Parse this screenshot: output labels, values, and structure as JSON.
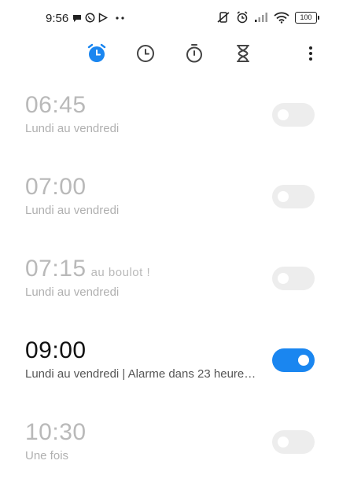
{
  "status_bar": {
    "time": "9:56",
    "battery": "100"
  },
  "tabs": [
    {
      "name": "alarm",
      "icon": "alarm-clock-icon",
      "active": true
    },
    {
      "name": "world-clock",
      "icon": "clock-icon",
      "active": false
    },
    {
      "name": "stopwatch",
      "icon": "stopwatch-icon",
      "active": false
    },
    {
      "name": "timer",
      "icon": "hourglass-icon",
      "active": false
    }
  ],
  "alarms": [
    {
      "time": "06:45",
      "label": "",
      "repeat": "Lundi au vendredi",
      "enabled": false
    },
    {
      "time": "07:00",
      "label": "",
      "repeat": "Lundi au vendredi",
      "enabled": false
    },
    {
      "time": "07:15",
      "label": "au boulot !",
      "repeat": "Lundi au vendredi",
      "enabled": false
    },
    {
      "time": "09:00",
      "label": "",
      "repeat": "Lundi au vendredi  |  Alarme dans 23 heure…",
      "enabled": true
    },
    {
      "time": "10:30",
      "label": "",
      "repeat": "Une fois",
      "enabled": false
    }
  ],
  "colors": {
    "accent": "#1a86f0",
    "inactive_text": "#b9b9b9",
    "toggle_off": "#ededed"
  }
}
